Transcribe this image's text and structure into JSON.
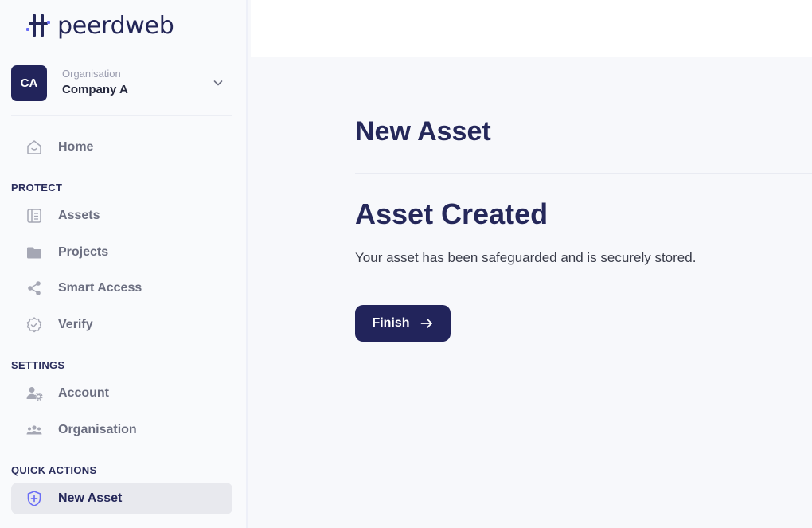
{
  "brand": {
    "name": "peerdweb",
    "accent": "#22245b",
    "logo_accent": "#6b6ef5"
  },
  "org": {
    "initials": "CA",
    "label": "Organisation",
    "name": "Company A"
  },
  "nav": {
    "home": {
      "label": "Home",
      "icon": "home-icon"
    },
    "protect": {
      "title": "PROTECT",
      "items": [
        {
          "label": "Assets",
          "icon": "assets-icon"
        },
        {
          "label": "Projects",
          "icon": "folder-icon"
        },
        {
          "label": "Smart Access",
          "icon": "share-icon"
        },
        {
          "label": "Verify",
          "icon": "verify-badge-icon"
        }
      ]
    },
    "settings": {
      "title": "SETTINGS",
      "items": [
        {
          "label": "Account",
          "icon": "user-gear-icon"
        },
        {
          "label": "Organisation",
          "icon": "users-icon"
        }
      ]
    },
    "quick_actions": {
      "title": "QUICK ACTIONS",
      "items": [
        {
          "label": "New Asset",
          "icon": "shield-plus-icon",
          "active": true
        }
      ]
    }
  },
  "main": {
    "page_title": "New Asset",
    "result_title": "Asset Created",
    "result_text": "Your asset has been safeguarded and is securely stored.",
    "finish_label": "Finish"
  }
}
